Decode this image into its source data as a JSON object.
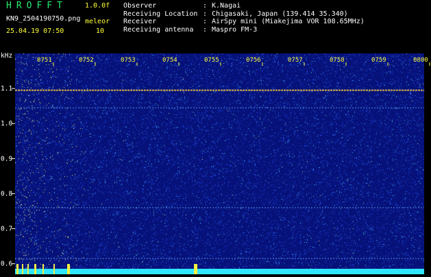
{
  "header": {
    "app_title": "HROFFT",
    "version": "1.0.0f",
    "filename": "KN9_2504190750.png",
    "program_label": "meleor",
    "program_value": "10",
    "datetime": "25.04.19 07:50"
  },
  "info": [
    {
      "label": "Observer",
      "value": "K.Nagai"
    },
    {
      "label": "Receiving Location",
      "value": "Chigasaki, Japan (139.414 35.340)"
    },
    {
      "label": "Receiver",
      "value": "AirSpy mini (Miakejima VOR 108.65MHz)"
    },
    {
      "label": "Receiving antenna",
      "value": "Maspro FM-3"
    }
  ],
  "info_separator": ":",
  "colors": {
    "background": "#000000",
    "plot_background": "#06127a",
    "accent_text": "#ffff3a",
    "title_green": "#27f070",
    "label_white": "#ffffff",
    "noise_floor": "#1a3ad0",
    "signal_line": "#e8c040",
    "baseline_cyan": "#2ee6ff"
  },
  "chart_data": {
    "type": "heatmap",
    "title": "",
    "xlabel": "",
    "ylabel": "kHz",
    "x_ticks": [
      "0751",
      "0752",
      "0753",
      "0754",
      "0755",
      "0756",
      "0757",
      "0758",
      "0759",
      "0800"
    ],
    "y_ticks": [
      "1.1",
      "1.0",
      "0.9",
      "0.8",
      "0.7",
      "0.6"
    ],
    "y_range_khz": [
      0.57,
      1.2
    ],
    "x_range_minutes": [
      "07:50",
      "08:00"
    ],
    "persistent_carriers_khz": [
      1.095,
      1.045,
      0.76,
      0.615
    ],
    "strongest_carrier_khz": 1.095,
    "grid": false,
    "legend": "none"
  }
}
